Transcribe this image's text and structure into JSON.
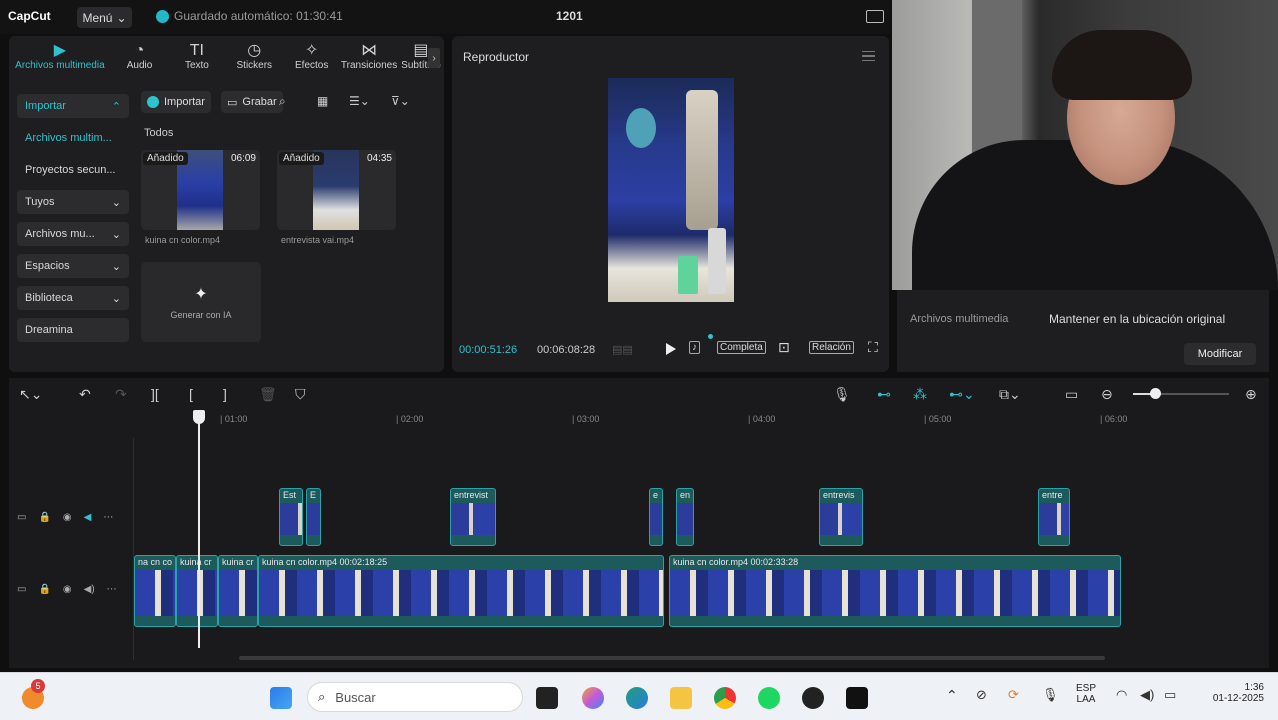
{
  "titlebar": {
    "logo": "CapCut",
    "menu_label": "Menú",
    "autosave": "Guardado automático: 01:30:41",
    "project_title": "1201"
  },
  "media_tabs": [
    {
      "label": "Archivos multimedia",
      "icon": "▶"
    },
    {
      "label": "Audio",
      "icon": "◔"
    },
    {
      "label": "Texto",
      "icon": "TI"
    },
    {
      "label": "Stickers",
      "icon": "◷"
    },
    {
      "label": "Efectos",
      "icon": "✧"
    },
    {
      "label": "Transiciones",
      "icon": "⋈"
    },
    {
      "label": "Subtítulo",
      "icon": "▤"
    }
  ],
  "sidebar": {
    "items": [
      {
        "label": "Importar",
        "chevron": "⌃"
      },
      {
        "label": "Archivos multim...",
        "chevron": ""
      },
      {
        "label": "Proyectos secun...",
        "chevron": ""
      },
      {
        "label": "Tuyos",
        "chevron": "⌄"
      },
      {
        "label": "Archivos mu...",
        "chevron": "⌄"
      },
      {
        "label": "Espacios",
        "chevron": "⌄"
      },
      {
        "label": "Biblioteca",
        "chevron": "⌄"
      },
      {
        "label": "Dreamina",
        "chevron": ""
      }
    ]
  },
  "media": {
    "import_label": "Importar",
    "record_label": "Grabar",
    "filter_all": "Todos",
    "files": [
      {
        "badge": "Añadido",
        "duration": "06:09",
        "name": "kuina cn color.mp4"
      },
      {
        "badge": "Añadido",
        "duration": "04:35",
        "name": "entrevista vai.mp4"
      }
    ],
    "generate_ai": "Generar con IA"
  },
  "player": {
    "title": "Reproductor",
    "current_time": "00:00:51:26",
    "total_time": "00:06:08:28",
    "full_label": "Completa",
    "ratio_label": "Relación"
  },
  "settings": {
    "label": "Archivos multimedia",
    "value": "Mantener en la ubicación original",
    "modify_label": "Modificar"
  },
  "timeline": {
    "ruler": [
      "| 01:00",
      "| 02:00",
      "| 03:00",
      "| 04:00",
      "| 05:00",
      "| 06:00"
    ],
    "overlay_clips": [
      "Est",
      "E",
      "entrevist",
      "e",
      "en",
      "entrevis",
      "entre"
    ],
    "main_clips": [
      {
        "label": "na cn co"
      },
      {
        "label": "kuina cr"
      },
      {
        "label": "kuina cr"
      },
      {
        "label": "kuina cn color.mp4   00:02:18:25"
      },
      {
        "label": "kuina cn color.mp4   00:02:33:28"
      }
    ]
  },
  "taskbar": {
    "search_placeholder": "Buscar",
    "notification_count": "5",
    "lang_top": "ESP",
    "lang_bottom": "LAA",
    "time": "1:36",
    "date": "01-12-2025"
  },
  "colors": {
    "accent": "#2cc3cf",
    "panel": "#1e1e20",
    "clip": "#1d5a5c"
  }
}
